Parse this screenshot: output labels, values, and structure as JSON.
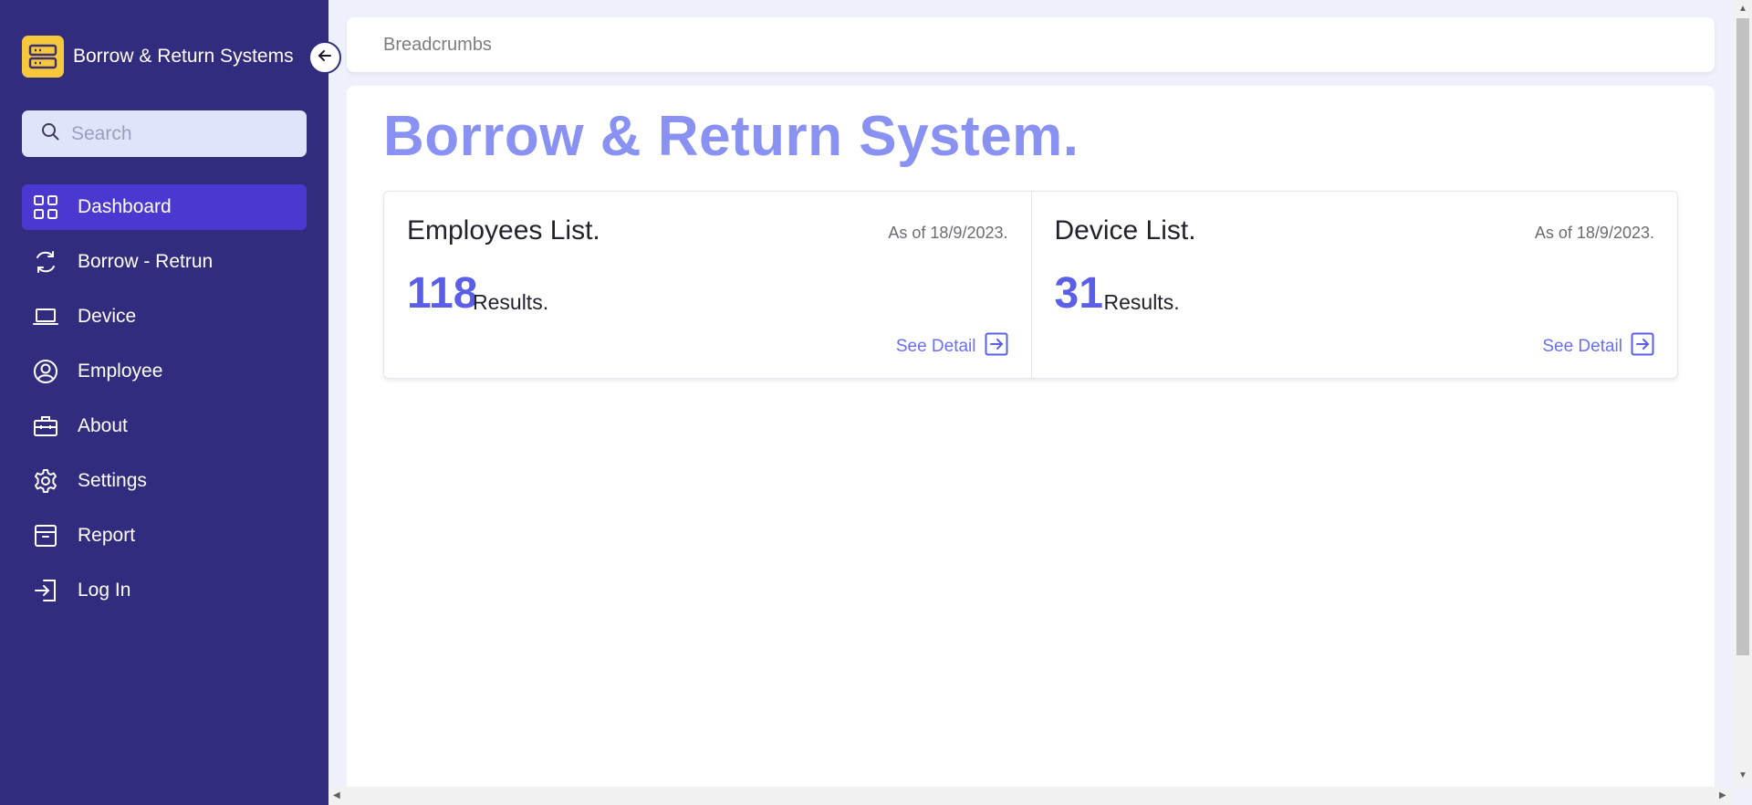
{
  "sidebar": {
    "brand_title": "Borrow & Return Systems",
    "search_placeholder": "Search",
    "items": [
      {
        "label": "Dashboard",
        "icon": "grid-icon",
        "active": true
      },
      {
        "label": "Borrow - Retrun",
        "icon": "refresh-icon"
      },
      {
        "label": "Device",
        "icon": "laptop-icon"
      },
      {
        "label": "Employee",
        "icon": "user-circle-icon"
      },
      {
        "label": "About",
        "icon": "briefcase-icon"
      },
      {
        "label": "Settings",
        "icon": "gear-icon"
      },
      {
        "label": "Report",
        "icon": "archive-box-icon"
      },
      {
        "label": "Log In",
        "icon": "login-icon"
      }
    ]
  },
  "breadcrumb": {
    "text": "Breadcrumbs"
  },
  "main": {
    "title": "Borrow & Return System.",
    "cards": [
      {
        "title": "Employees List.",
        "date": "As of 18/9/2023.",
        "count": "118",
        "count_label": "Results.",
        "link": "See Detail"
      },
      {
        "title": "Device List.",
        "date": "As of 18/9/2023.",
        "count": "31",
        "count_label": "Results.",
        "link": "See Detail"
      }
    ]
  },
  "colors": {
    "sidebar_bg": "#322c7e",
    "active_item": "#4a38d0",
    "accent": "#5b5fe8",
    "title": "#8992f3",
    "logo": "#f6c93c"
  }
}
